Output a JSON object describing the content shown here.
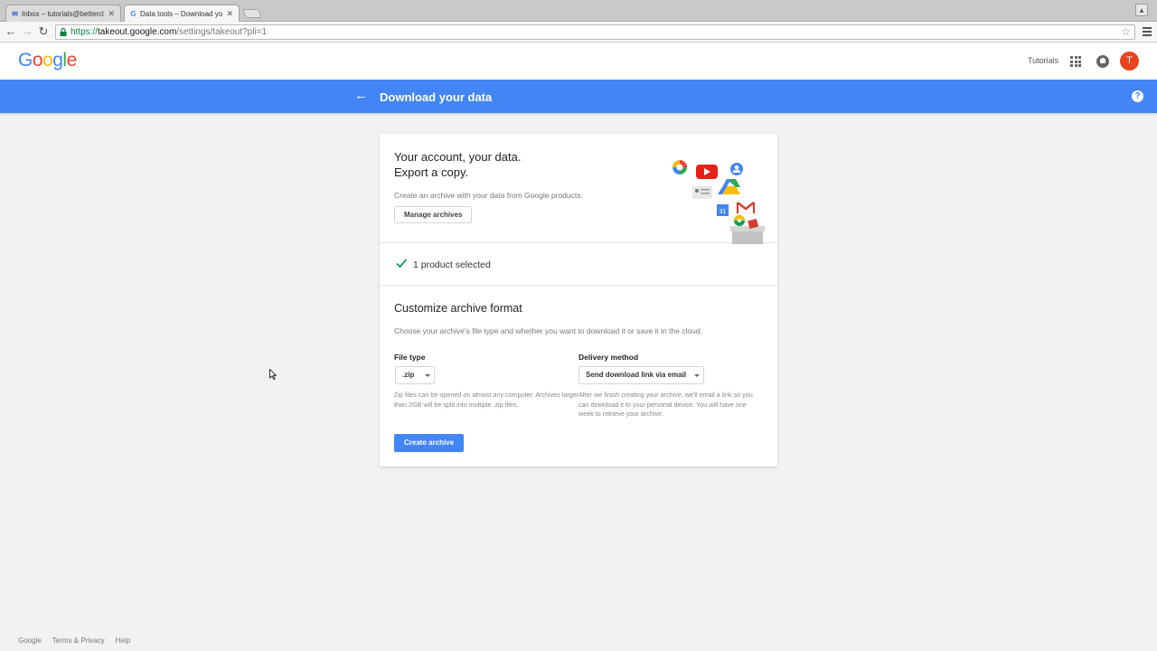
{
  "browser": {
    "tabs": [
      {
        "title": "Inbox – tutorials@bettercl",
        "active": false,
        "favicon": "mail-icon"
      },
      {
        "title": "Data tools – Download yo",
        "active": true,
        "favicon": "google-g-icon"
      }
    ],
    "url": {
      "scheme": "https://",
      "domain": "takeout.google.com",
      "path": "/settings/takeout?pli=1"
    }
  },
  "header": {
    "logo": {
      "G": "G",
      "o1": "o",
      "o2": "o",
      "g": "g",
      "l": "l",
      "e": "e"
    },
    "user_label": "Tutorials",
    "avatar_letter": "T"
  },
  "bluebar": {
    "title": "Download your data"
  },
  "intro": {
    "line1": "Your account, your data.",
    "line2": "Export a copy.",
    "description": "Create an archive with your data from Google products.",
    "manage_button": "Manage archives"
  },
  "selection": {
    "text": "1 product selected"
  },
  "format": {
    "title": "Customize archive format",
    "description": "Choose your archive's file type and whether you want to download it or save it in the cloud.",
    "file_type": {
      "label": "File type",
      "value": ".zip",
      "help": "Zip files can be opened on almost any computer. Archives larger than 2GB will be split into multiple .zip files."
    },
    "delivery": {
      "label": "Delivery method",
      "value": "Send download link via email",
      "help": "After we finish creating your archive, we'll email a link so you can download it to your personal device. You will have one week to retrieve your archive."
    },
    "create_button": "Create archive"
  },
  "footer": {
    "links": [
      "Google",
      "Terms & Privacy",
      "Help"
    ]
  },
  "colors": {
    "brand_blue": "#4285f4",
    "avatar": "#e8441c",
    "check_green": "#0f9d58"
  }
}
